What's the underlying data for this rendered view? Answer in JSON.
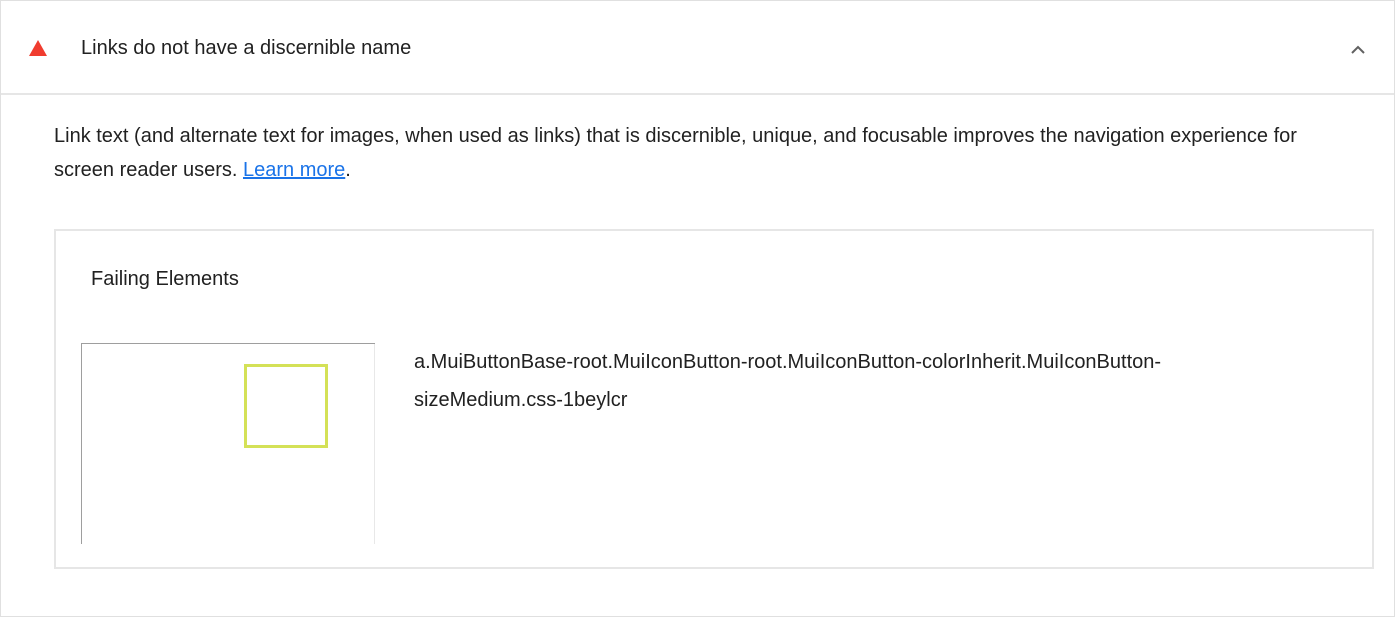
{
  "audit": {
    "title": "Links do not have a discernible name",
    "status_color": "#f03c2f",
    "expanded": true,
    "description_text": "Link text (and alternate text for images, when used as links) that is discernible, unique, and focusable improves the navigation experience for screen reader users. ",
    "learn_more_label": "Learn more",
    "description_end": "."
  },
  "details": {
    "heading": "Failing Elements",
    "items": [
      {
        "selector_line1": "a.MuiButtonBase-root.MuiIconButton-root.MuiIconButton-colorInherit.MuiIconButton-",
        "selector_line2": "sizeMedium.css-1beylcr",
        "highlight_color": "#d4e157"
      }
    ]
  },
  "icons": {
    "status": "fail-triangle-icon",
    "toggle": "chevron-up-icon"
  }
}
